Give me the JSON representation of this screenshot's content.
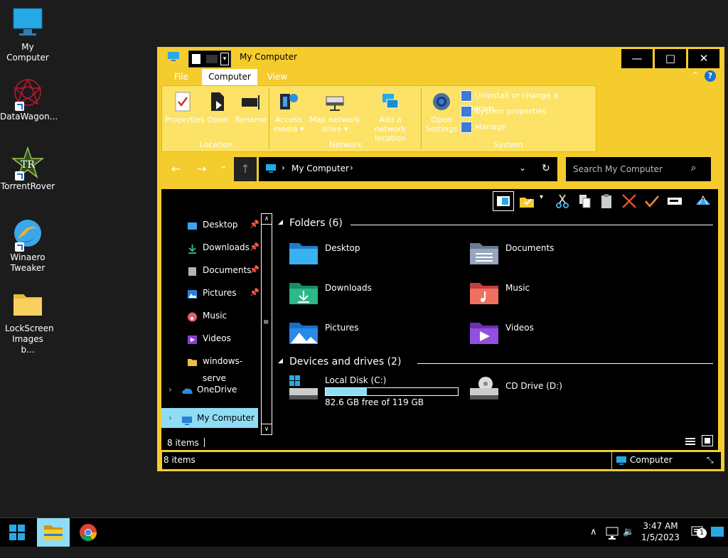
{
  "desktop": {
    "icons": [
      {
        "label": "My Computer",
        "icon": "monitor-icon"
      },
      {
        "label": "DataWagon...",
        "icon": "datawagon-icon"
      },
      {
        "label": "TorrentRover",
        "icon": "torrentrover-icon"
      },
      {
        "label": "Winaero Tweaker",
        "icon": "winaero-icon"
      },
      {
        "label": "LockScreen Images b...",
        "icon": "folder-icon"
      }
    ]
  },
  "window": {
    "title": "My Computer",
    "controls": {
      "minimize": "—",
      "maximize": "□",
      "close": "✕"
    },
    "tabs": [
      "File",
      "Computer",
      "View"
    ],
    "active_tab": "Computer",
    "help": "?",
    "ribbon": {
      "location": {
        "label": "Location",
        "buttons": [
          "Properties",
          "Open",
          "Rename"
        ]
      },
      "network": {
        "label": "Network",
        "buttons": [
          "Access media ▾",
          "Map network drive ▾",
          "Add a network location"
        ]
      },
      "system": {
        "label": "System",
        "open_settings": "Open Settings",
        "links": [
          "Uninstall or change a program",
          "System properties",
          "Manage"
        ]
      }
    },
    "nav": {
      "back": "←",
      "forward": "→",
      "recent": "⌄",
      "up": "↑",
      "address": "My Computer",
      "search_placeholder": "Search My Computer"
    },
    "navpane": {
      "items": [
        {
          "label": "Desktop",
          "pinned": true
        },
        {
          "label": "Downloads",
          "pinned": true
        },
        {
          "label": "Documents",
          "pinned": true
        },
        {
          "label": "Pictures",
          "pinned": true
        },
        {
          "label": "Music",
          "pinned": false
        },
        {
          "label": "Videos",
          "pinned": false
        },
        {
          "label": "windows-serve",
          "pinned": false
        },
        {
          "label": "OneDrive",
          "pinned": false
        },
        {
          "label": "My Computer",
          "pinned": false
        }
      ],
      "selected": "My Computer"
    },
    "folders_header": "Folders (6)",
    "folders": [
      "Desktop",
      "Documents",
      "Downloads",
      "Music",
      "Pictures",
      "Videos"
    ],
    "drives_header": "Devices and drives (2)",
    "drives": [
      {
        "name": "Local Disk (C:)",
        "free": "82.6 GB free of 119 GB",
        "used_fraction": 0.31
      },
      {
        "name": "CD Drive (D:)"
      }
    ],
    "items_count_inner": "8 items",
    "status": {
      "items": "8 items",
      "location": "Computer"
    }
  },
  "taskbar": {
    "time": "3:47 AM",
    "date": "1/5/2023",
    "notification_count": "1"
  },
  "colors": {
    "accent": "#f5cc2e",
    "selected": "#8fdcf5",
    "drive_bar": "#8fdcf5"
  }
}
